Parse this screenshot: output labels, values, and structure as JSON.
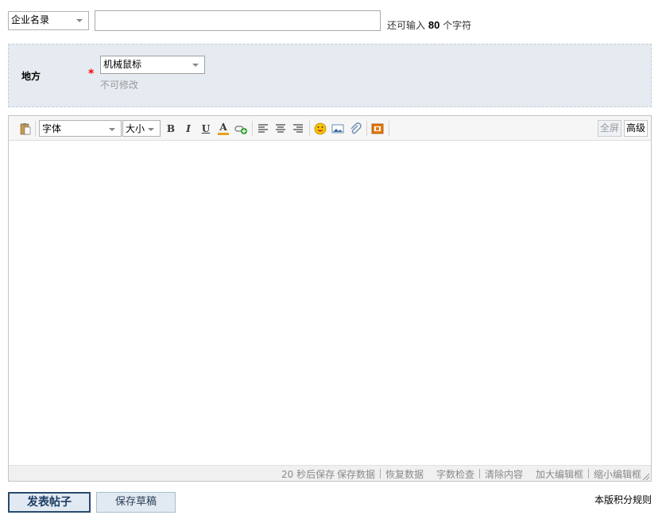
{
  "category": {
    "selected": "企业名录"
  },
  "title": {
    "value": "",
    "hint_prefix": "还可输入",
    "remaining": "80",
    "hint_suffix": "个字符"
  },
  "place": {
    "label": "地方",
    "required": "*",
    "selected": "机械鼠标",
    "note": "不可修改"
  },
  "toolbar": {
    "font_label": "字体",
    "size_label": "大小",
    "bold": "B",
    "italic": "I",
    "underline": "U",
    "font_color": "A",
    "fullscreen": "全屏",
    "advanced": "高级",
    "colors": {
      "font_color_bar": "#e8a020",
      "emoticon": "#f5c400"
    }
  },
  "status": {
    "autosave": "20 秒后保存",
    "save_data": "保存数据",
    "restore_data": "恢复数据",
    "word_check": "字数检查",
    "clear_content": "清除内容",
    "enlarge": "加大编辑框",
    "shrink": "缩小编辑框"
  },
  "actions": {
    "publish": "发表帖子",
    "save_draft": "保存草稿",
    "rules": "本版积分规则"
  }
}
